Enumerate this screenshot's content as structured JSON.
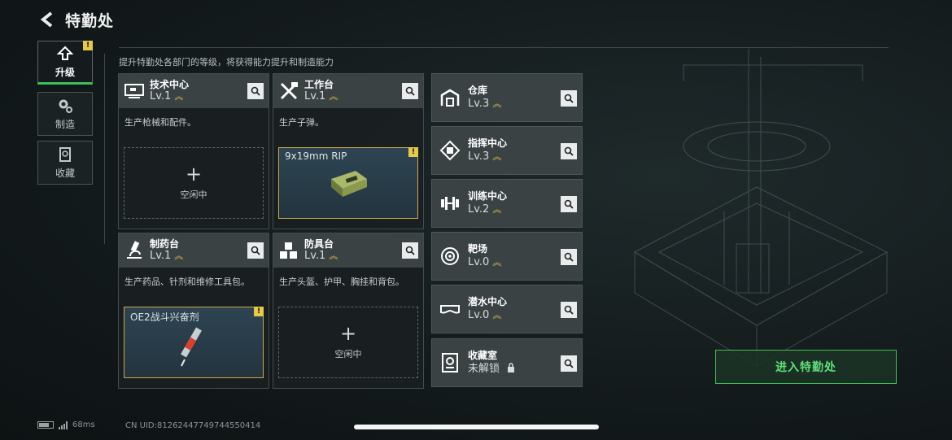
{
  "header": {
    "title": "特勤处"
  },
  "tabs": [
    {
      "label": "升级",
      "icon": "upgrade-icon",
      "active": true,
      "badge": "!"
    },
    {
      "label": "制造",
      "icon": "gear-icon",
      "active": false
    },
    {
      "label": "收藏",
      "icon": "collection-icon",
      "active": false
    }
  ],
  "description": "提升特勤处各部门的等级，将获得能力提升和制造能力",
  "facilities": [
    {
      "name": "技术中心",
      "level": "Lv.1",
      "desc": "生产枪械和配件。",
      "slot_state": "空闲中"
    },
    {
      "name": "工作台",
      "level": "Lv.1",
      "desc": "生产子弹。",
      "slot_item": "9x19mm RIP",
      "badge": "!"
    },
    {
      "name": "制药台",
      "level": "Lv.1",
      "desc": "生产药品、针剂和维修工具包。",
      "slot_item": "OE2战斗兴奋剂",
      "badge": "!"
    },
    {
      "name": "防具台",
      "level": "Lv.1",
      "desc": "生产头盔、护甲、胸挂和背包。",
      "slot_state": "空闲中"
    }
  ],
  "plus": "+",
  "rooms": [
    {
      "name": "仓库",
      "level": "Lv.3"
    },
    {
      "name": "指挥中心",
      "level": "Lv.3"
    },
    {
      "name": "训练中心",
      "level": "Lv.2"
    },
    {
      "name": "靶场",
      "level": "Lv.0"
    },
    {
      "name": "潜水中心",
      "level": "Lv.0"
    },
    {
      "name": "收藏室",
      "level": "未解锁"
    }
  ],
  "enter_button": "进入特勤处",
  "status": {
    "ping": "68ms",
    "uid": "CN UID:81262447749744550414"
  },
  "colors": {
    "accent": "#3fbf5a",
    "warning": "#e6c84a"
  }
}
